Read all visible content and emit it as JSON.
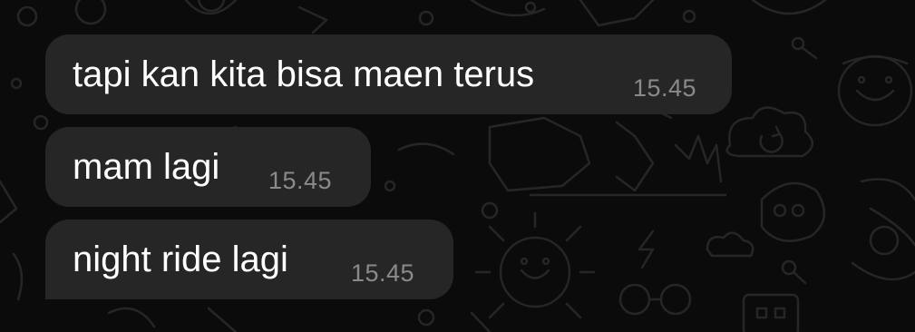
{
  "chat": {
    "background_color": "#0b0b0b",
    "bubble_color": "#262626",
    "text_color": "#ffffff",
    "time_color": "#8a8a8a",
    "messages": [
      {
        "text": "tapi kan kita bisa maen terus",
        "time": "15.45"
      },
      {
        "text": "mam lagi",
        "time": "15.45"
      },
      {
        "text": "night ride lagi",
        "time": "15.45"
      }
    ]
  }
}
